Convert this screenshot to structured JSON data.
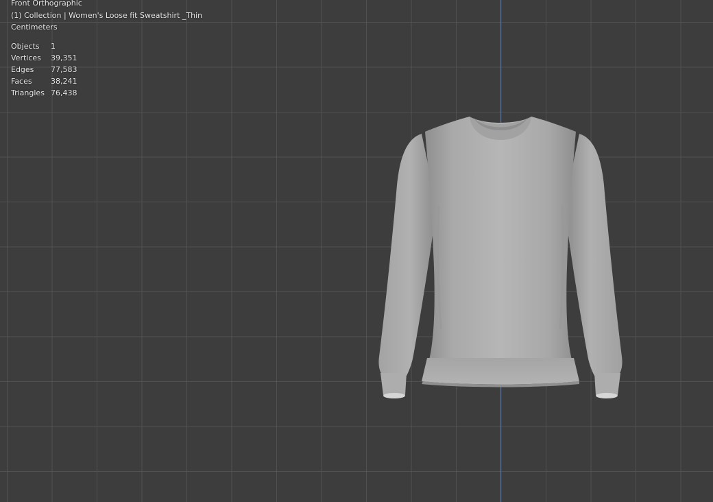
{
  "viewport": {
    "view_name": "Front Orthographic",
    "collection_line": "(1) Collection | Women's Loose fit Sweatshirt _Thin",
    "units": "Centimeters",
    "stats": [
      {
        "label": "Objects",
        "value": "1"
      },
      {
        "label": "Vertices",
        "value": "39,351"
      },
      {
        "label": "Edges",
        "value": "77,583"
      },
      {
        "label": "Faces",
        "value": "38,241"
      },
      {
        "label": "Triangles",
        "value": "76,438"
      }
    ]
  },
  "colors": {
    "background": "#3d3d3d",
    "grid": "#555555",
    "z_axis": "#4f77b3",
    "text": "#e6e6e6",
    "mesh": "#b4b4b4"
  }
}
